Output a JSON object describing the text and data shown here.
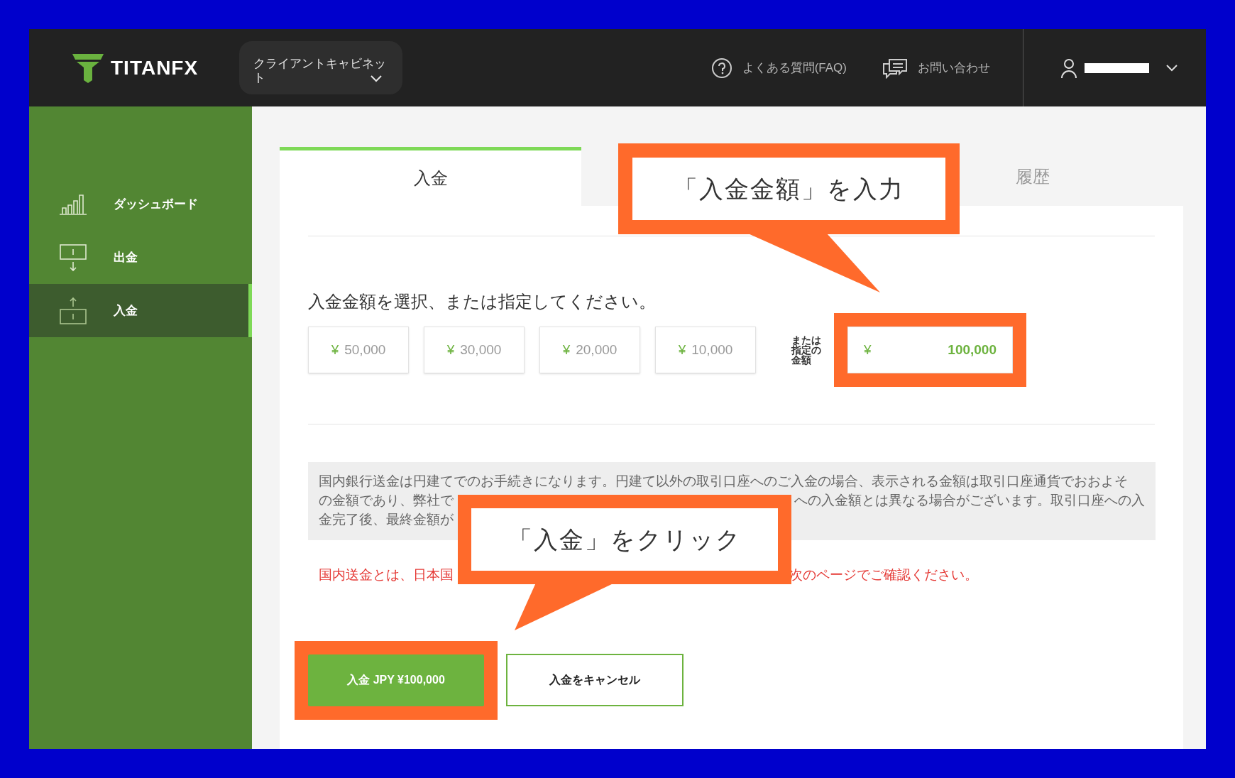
{
  "header": {
    "logo": "TITANFX",
    "cabinet_menu": "クライアントキャビネット",
    "links": [
      {
        "label": "よくある質問(FAQ)",
        "kind": "help"
      },
      {
        "label": "お問い合わせ",
        "kind": "chat"
      }
    ]
  },
  "sidebar": {
    "items": [
      {
        "label": "ダッシュボード",
        "kind": "chart",
        "selected": false
      },
      {
        "label": "出金",
        "kind": "withdraw",
        "selected": false
      },
      {
        "label": "入金",
        "kind": "deposit",
        "selected": true
      }
    ]
  },
  "tabs": [
    {
      "label": "入金",
      "selected": true
    },
    {
      "label": "履歴",
      "selected": false
    }
  ],
  "deposit": {
    "heading": "入金金額を選択、または指定してください。",
    "preset_amounts": [
      {
        "currency": "¥",
        "amount": "50,000"
      },
      {
        "currency": "¥",
        "amount": "30,000"
      },
      {
        "currency": "¥",
        "amount": "20,000"
      },
      {
        "currency": "¥",
        "amount": "10,000"
      }
    ],
    "custom_label": "または指定の金額",
    "custom_currency": "¥",
    "custom_value": "100,000",
    "custom_highlighted": true,
    "notice_lines": [
      [
        "国内銀行送金は円建てでのお手続きになります。円建て以外の取引口座へのご入金の場合、表示される金額は取引口座通貨でおおよそ"
      ],
      [
        "の金額であり、弊社で",
        "への入金額とは異なる場合がございます。取引口座への入"
      ],
      [
        "金完了後、最終金額が"
      ]
    ],
    "warning": [
      "国内送金とは、日本国",
      "次のページでご確認ください。"
    ],
    "buttons": [
      {
        "label": "入金 JPY ¥100,000",
        "kind": "primary",
        "highlighted": true
      },
      {
        "label": "入金をキャンセル",
        "kind": "secondary",
        "highlighted": false
      }
    ]
  },
  "callouts": [
    {
      "text": "「入金金額」を入力",
      "kind": "up"
    },
    {
      "text": "「入金」をクリック",
      "kind": "down"
    }
  ]
}
